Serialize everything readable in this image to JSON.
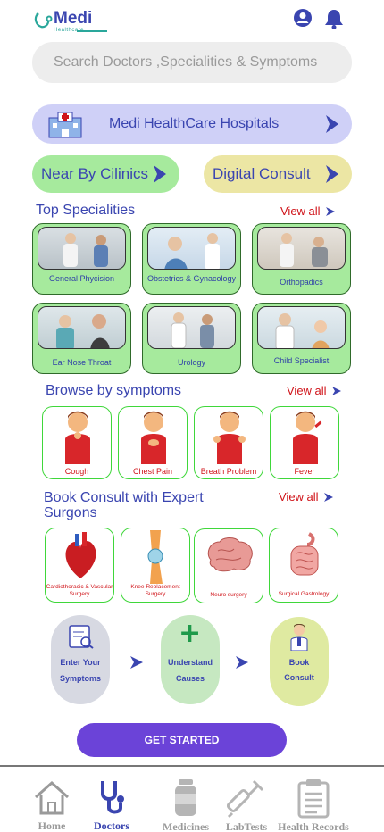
{
  "brand": {
    "name": "Medi",
    "tagline": "Healthcare"
  },
  "search": {
    "placeholder": "Search Doctors ,Specialities &  Symptoms"
  },
  "hospital_banner": {
    "label": "Medi HealthCare  Hospitals"
  },
  "quick_links": {
    "nearby": "Near By Cilinics",
    "digital": "Digital Consult"
  },
  "specialities": {
    "title": "Top Specialities",
    "view_all": "View all",
    "items": [
      {
        "label": "General Phycision"
      },
      {
        "label": "Obstetrics & Gynacology"
      },
      {
        "label": "Orthopadics"
      },
      {
        "label": "Ear Nose Throat"
      },
      {
        "label": "Urology"
      },
      {
        "label": "Child Specialist"
      }
    ]
  },
  "symptoms": {
    "title": "Browse by symptoms",
    "view_all": "View all",
    "items": [
      {
        "label": "Cough"
      },
      {
        "label": "Chest Pain"
      },
      {
        "label": "Breath Problem"
      },
      {
        "label": "Fever"
      }
    ]
  },
  "surgeons": {
    "title": "Book Consult with Expert Surgons",
    "view_all": "View all",
    "items": [
      {
        "label": "Cardiothoracic & Vascular Surgery"
      },
      {
        "label": "Knee Replacement Surgery"
      },
      {
        "label": "Neuro surgery"
      },
      {
        "label": "Surgical Gastrology"
      }
    ]
  },
  "steps": [
    {
      "line1": "Enter Your",
      "line2": "Symptoms"
    },
    {
      "line1": "Understand",
      "line2": "Causes"
    },
    {
      "line1": "Book",
      "line2": "Consult"
    }
  ],
  "cta": {
    "label": "GET STARTED"
  },
  "nav": [
    {
      "label": "Home"
    },
    {
      "label": "Doctors"
    },
    {
      "label": "Medicines"
    },
    {
      "label": "LabTests"
    },
    {
      "label": "Health Records"
    }
  ],
  "colors": {
    "accent": "#3a45b0",
    "view_all": "#d0141a",
    "card_green": "#a6ea9d",
    "cta": "#6b43d8"
  }
}
